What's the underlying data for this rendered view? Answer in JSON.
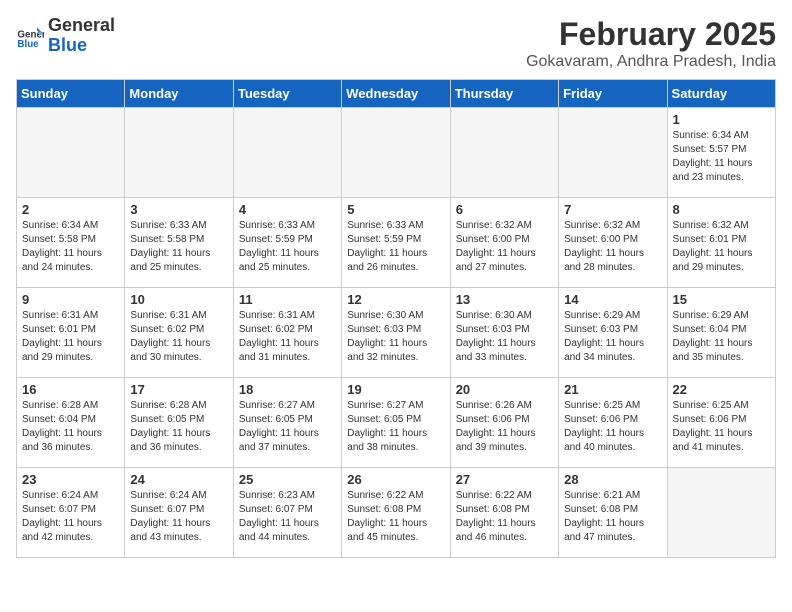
{
  "header": {
    "logo_general": "General",
    "logo_blue": "Blue",
    "month_year": "February 2025",
    "location": "Gokavaram, Andhra Pradesh, India"
  },
  "weekdays": [
    "Sunday",
    "Monday",
    "Tuesday",
    "Wednesday",
    "Thursday",
    "Friday",
    "Saturday"
  ],
  "weeks": [
    [
      {
        "num": "",
        "info": ""
      },
      {
        "num": "",
        "info": ""
      },
      {
        "num": "",
        "info": ""
      },
      {
        "num": "",
        "info": ""
      },
      {
        "num": "",
        "info": ""
      },
      {
        "num": "",
        "info": ""
      },
      {
        "num": "1",
        "info": "Sunrise: 6:34 AM\nSunset: 5:57 PM\nDaylight: 11 hours and 23 minutes."
      }
    ],
    [
      {
        "num": "2",
        "info": "Sunrise: 6:34 AM\nSunset: 5:58 PM\nDaylight: 11 hours and 24 minutes."
      },
      {
        "num": "3",
        "info": "Sunrise: 6:33 AM\nSunset: 5:58 PM\nDaylight: 11 hours and 25 minutes."
      },
      {
        "num": "4",
        "info": "Sunrise: 6:33 AM\nSunset: 5:59 PM\nDaylight: 11 hours and 25 minutes."
      },
      {
        "num": "5",
        "info": "Sunrise: 6:33 AM\nSunset: 5:59 PM\nDaylight: 11 hours and 26 minutes."
      },
      {
        "num": "6",
        "info": "Sunrise: 6:32 AM\nSunset: 6:00 PM\nDaylight: 11 hours and 27 minutes."
      },
      {
        "num": "7",
        "info": "Sunrise: 6:32 AM\nSunset: 6:00 PM\nDaylight: 11 hours and 28 minutes."
      },
      {
        "num": "8",
        "info": "Sunrise: 6:32 AM\nSunset: 6:01 PM\nDaylight: 11 hours and 29 minutes."
      }
    ],
    [
      {
        "num": "9",
        "info": "Sunrise: 6:31 AM\nSunset: 6:01 PM\nDaylight: 11 hours and 29 minutes."
      },
      {
        "num": "10",
        "info": "Sunrise: 6:31 AM\nSunset: 6:02 PM\nDaylight: 11 hours and 30 minutes."
      },
      {
        "num": "11",
        "info": "Sunrise: 6:31 AM\nSunset: 6:02 PM\nDaylight: 11 hours and 31 minutes."
      },
      {
        "num": "12",
        "info": "Sunrise: 6:30 AM\nSunset: 6:03 PM\nDaylight: 11 hours and 32 minutes."
      },
      {
        "num": "13",
        "info": "Sunrise: 6:30 AM\nSunset: 6:03 PM\nDaylight: 11 hours and 33 minutes."
      },
      {
        "num": "14",
        "info": "Sunrise: 6:29 AM\nSunset: 6:03 PM\nDaylight: 11 hours and 34 minutes."
      },
      {
        "num": "15",
        "info": "Sunrise: 6:29 AM\nSunset: 6:04 PM\nDaylight: 11 hours and 35 minutes."
      }
    ],
    [
      {
        "num": "16",
        "info": "Sunrise: 6:28 AM\nSunset: 6:04 PM\nDaylight: 11 hours and 36 minutes."
      },
      {
        "num": "17",
        "info": "Sunrise: 6:28 AM\nSunset: 6:05 PM\nDaylight: 11 hours and 36 minutes."
      },
      {
        "num": "18",
        "info": "Sunrise: 6:27 AM\nSunset: 6:05 PM\nDaylight: 11 hours and 37 minutes."
      },
      {
        "num": "19",
        "info": "Sunrise: 6:27 AM\nSunset: 6:05 PM\nDaylight: 11 hours and 38 minutes."
      },
      {
        "num": "20",
        "info": "Sunrise: 6:26 AM\nSunset: 6:06 PM\nDaylight: 11 hours and 39 minutes."
      },
      {
        "num": "21",
        "info": "Sunrise: 6:25 AM\nSunset: 6:06 PM\nDaylight: 11 hours and 40 minutes."
      },
      {
        "num": "22",
        "info": "Sunrise: 6:25 AM\nSunset: 6:06 PM\nDaylight: 11 hours and 41 minutes."
      }
    ],
    [
      {
        "num": "23",
        "info": "Sunrise: 6:24 AM\nSunset: 6:07 PM\nDaylight: 11 hours and 42 minutes."
      },
      {
        "num": "24",
        "info": "Sunrise: 6:24 AM\nSunset: 6:07 PM\nDaylight: 11 hours and 43 minutes."
      },
      {
        "num": "25",
        "info": "Sunrise: 6:23 AM\nSunset: 6:07 PM\nDaylight: 11 hours and 44 minutes."
      },
      {
        "num": "26",
        "info": "Sunrise: 6:22 AM\nSunset: 6:08 PM\nDaylight: 11 hours and 45 minutes."
      },
      {
        "num": "27",
        "info": "Sunrise: 6:22 AM\nSunset: 6:08 PM\nDaylight: 11 hours and 46 minutes."
      },
      {
        "num": "28",
        "info": "Sunrise: 6:21 AM\nSunset: 6:08 PM\nDaylight: 11 hours and 47 minutes."
      },
      {
        "num": "",
        "info": ""
      }
    ]
  ]
}
